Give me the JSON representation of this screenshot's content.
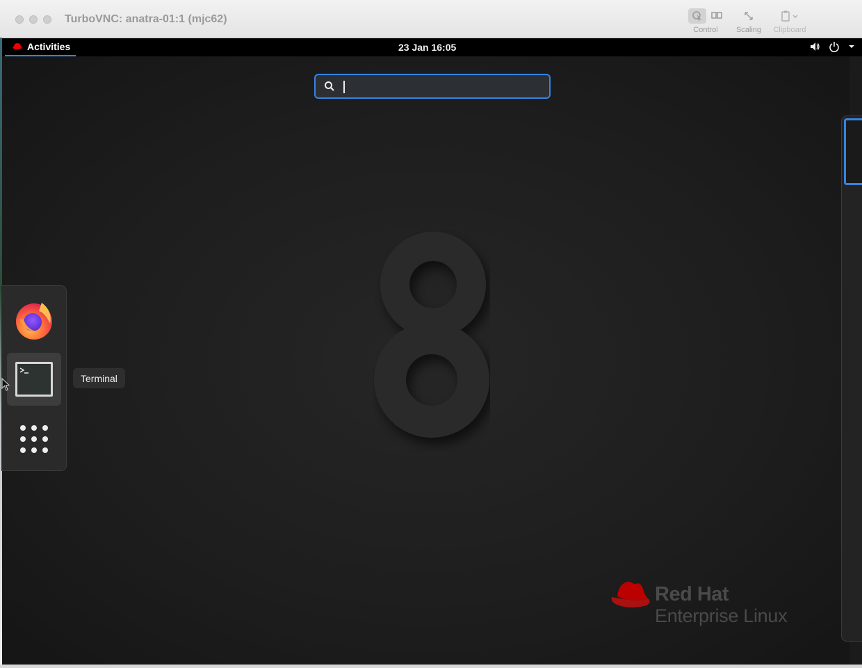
{
  "window": {
    "title": "TurboVNC: anatra-01:1 (mjc62)",
    "toolbar": [
      {
        "label": "Control",
        "icon": "control-icon"
      },
      {
        "label": "Scaling",
        "icon": "scaling-icon"
      },
      {
        "label": "Clipboard",
        "icon": "clipboard-icon"
      }
    ]
  },
  "topbar": {
    "activities": "Activities",
    "clock": "23 Jan  16:05",
    "tray_icons": [
      "volume-icon",
      "power-icon",
      "menu-arrow-icon"
    ]
  },
  "search": {
    "value": "",
    "placeholder": ""
  },
  "dash": {
    "items": [
      {
        "name": "Firefox",
        "icon": "firefox-icon"
      },
      {
        "name": "Terminal",
        "icon": "terminal-icon"
      },
      {
        "name": "Show Applications",
        "icon": "app-grid-icon"
      }
    ],
    "tooltip": "Terminal"
  },
  "branding": {
    "line1": "Red Hat",
    "line2": "Enterprise Linux",
    "version_glyph": "8"
  },
  "colors": {
    "accent": "#3584e4",
    "redhat_red": "#c00"
  }
}
